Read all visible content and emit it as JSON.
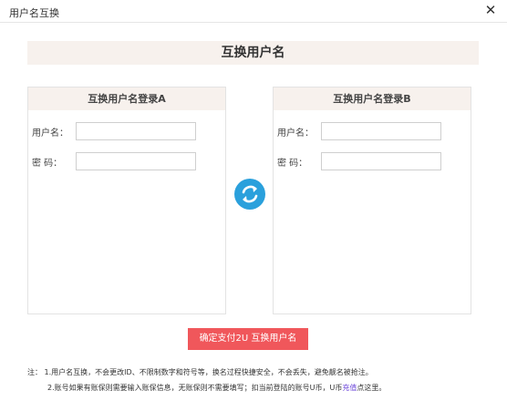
{
  "window": {
    "title": "用户名互换",
    "close_glyph": "✕"
  },
  "headline": "互换用户名",
  "panel_a": {
    "title": "互换用户名登录A",
    "username_label": "用户名：",
    "password_label": "密 码：",
    "username_value": "",
    "password_value": ""
  },
  "panel_b": {
    "title": "互换用户名登录B",
    "username_label": "用户名：",
    "password_label": "密 码：",
    "username_value": "",
    "password_value": ""
  },
  "swap": {
    "icon": "swap-arrows-icon",
    "color": "#2aa0dc"
  },
  "confirm_button": "确定支付2U 互换用户名",
  "notes": {
    "prefix": "注：",
    "line1": "1.用户名互换，不会更改ID、不限制数字和符号等，换名过程快捷安全，不会丢失，避免靓名被抢注。",
    "line2_a": "2.账号如果有账保则需要输入账保信息，无账保则不需要填写；扣当前登陆的账号U币，U币",
    "line2_link": "充值",
    "line2_b": "点这里。"
  },
  "colors": {
    "accent_red": "#f0575b",
    "header_bg": "#f7f1ed",
    "link": "#6b45d9"
  }
}
